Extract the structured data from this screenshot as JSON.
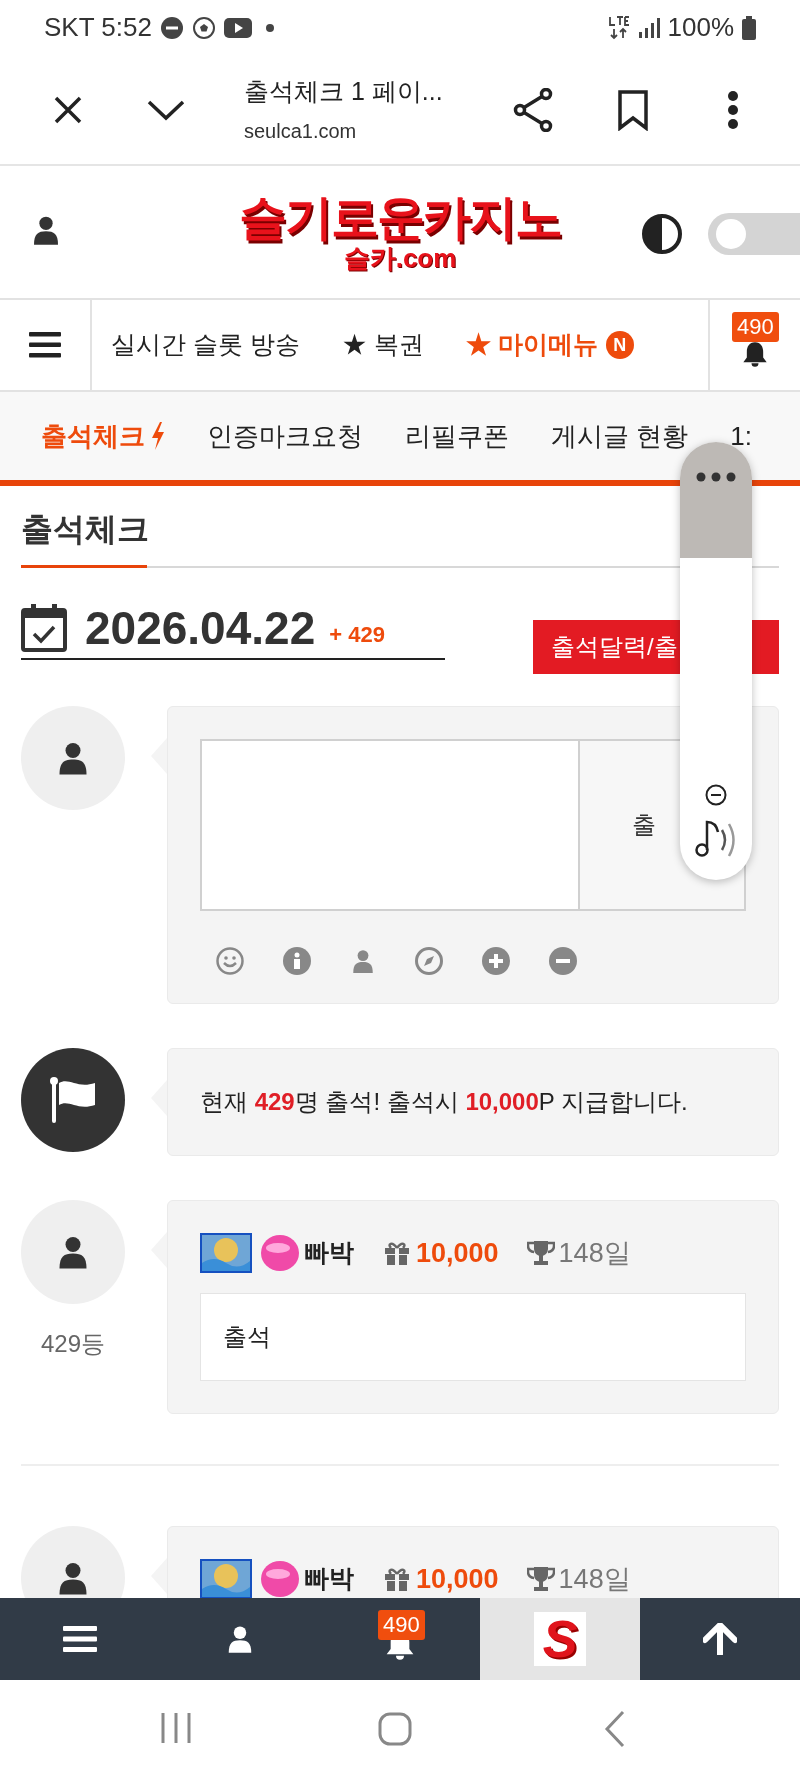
{
  "status_bar": {
    "carrier_time": "SKT 5:52",
    "battery": "100%"
  },
  "browser": {
    "title": "출석체크 1 페이...",
    "url": "seulca1.com"
  },
  "header": {
    "logo": "슬기로운카지노",
    "logo_sub": "슬카.com",
    "dark_mode": {
      "on": false
    }
  },
  "nav": {
    "items": [
      {
        "label": "실시간 슬롯 방송",
        "highlighted": false
      },
      {
        "label": "★ 복권",
        "highlighted": false
      },
      {
        "label": "★ 마이메뉴",
        "highlighted": true,
        "badge": "N"
      }
    ],
    "notifications": "490"
  },
  "tabs": [
    {
      "label": "출석체크",
      "selected": true
    },
    {
      "label": "인증마크요청",
      "selected": false
    },
    {
      "label": "리필쿠폰",
      "selected": false
    },
    {
      "label": "게시글 현황",
      "selected": false
    },
    {
      "label": "1:",
      "selected": false
    }
  ],
  "page_title": "출석체크",
  "date": {
    "value": "2026.04.22",
    "count": "+ 429"
  },
  "calendar_button": "출석달력/출",
  "form": {
    "submit": "출"
  },
  "notice": "현재 **429**명 출석! 출석시 **10,000**P 지급합니다.",
  "entries": [
    {
      "rank": "429등",
      "name": "빠박",
      "points": "10,000",
      "days": "148일",
      "message": "출석"
    },
    {
      "name": "빠박",
      "points": "10,000",
      "days": "148일"
    }
  ],
  "bottom_nav": {
    "notifications": "490",
    "logo": "S"
  }
}
